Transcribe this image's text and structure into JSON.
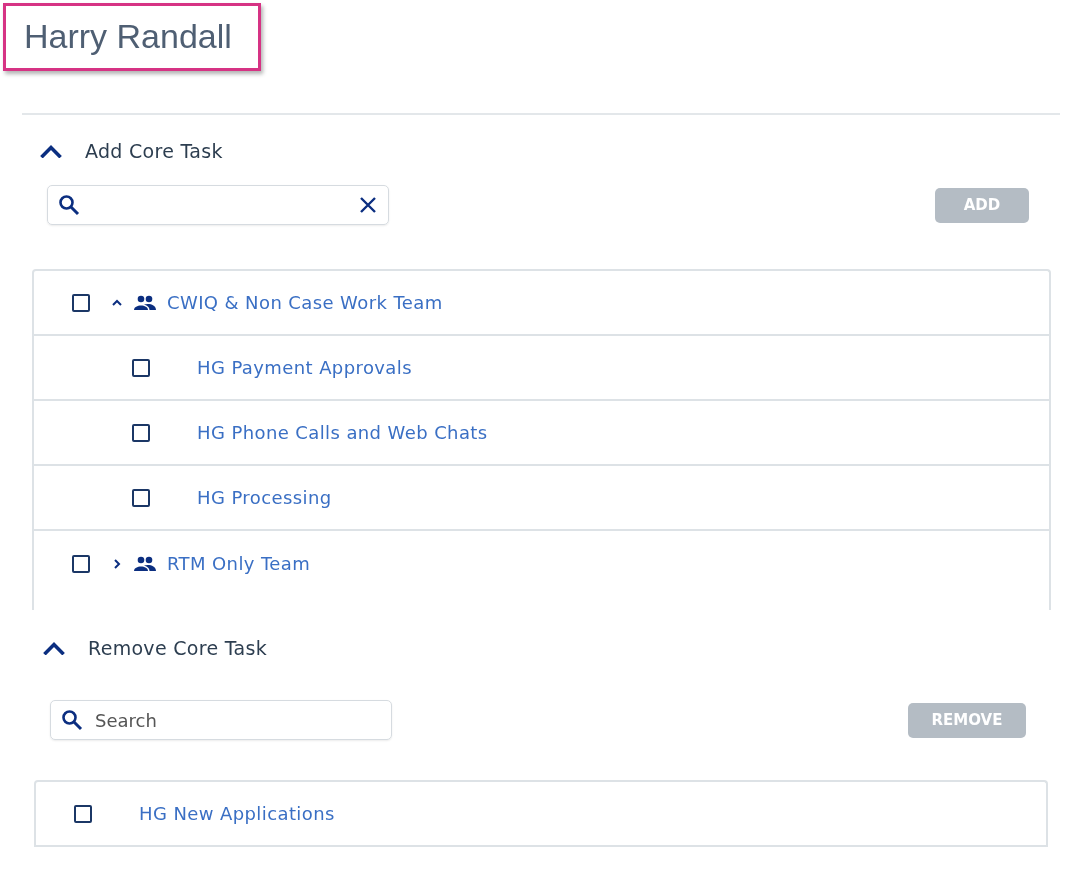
{
  "title": "Harry Randall",
  "sections": [
    {
      "title": "Add Core Task",
      "expanded": true,
      "search": {
        "clearable": true
      },
      "button": {
        "label": "ADD",
        "disabled": true
      },
      "items": [
        {
          "kind": "team",
          "label": "CWIQ & Non Case Work Team",
          "checked": false,
          "expanded": true,
          "children": [
            {
              "kind": "task",
              "label": "HG Payment Approvals",
              "checked": false
            },
            {
              "kind": "task",
              "label": "HG Phone Calls and Web Chats",
              "checked": false
            },
            {
              "kind": "task",
              "label": "HG Processing",
              "checked": false
            }
          ]
        },
        {
          "kind": "team",
          "label": "RTM Only Team",
          "checked": false,
          "expanded": false
        }
      ]
    },
    {
      "title": "Remove Core Task",
      "expanded": true,
      "search": {
        "placeholder": "Search",
        "clearable": false
      },
      "button": {
        "label": "REMOVE",
        "disabled": true
      },
      "items": [
        {
          "kind": "task",
          "label": "HG New Applications",
          "checked": false
        }
      ]
    }
  ]
}
